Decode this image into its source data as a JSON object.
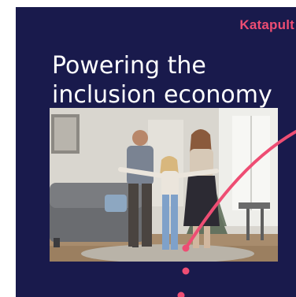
{
  "ad": {
    "brand": "Katapult",
    "headline_line1": "Powering the",
    "headline_line2": "inclusion economy",
    "colors": {
      "background": "#191a4c",
      "accent": "#ee4d73",
      "text": "#ffffff"
    },
    "photo_subject": "family-living-room-photo"
  }
}
